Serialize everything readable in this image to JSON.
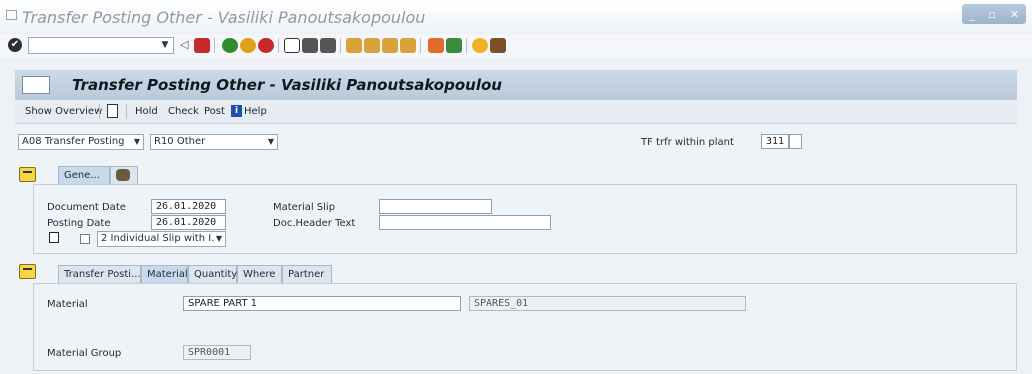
{
  "window": {
    "title": "Transfer Posting Other - Vasiliki Panoutsakopoulou",
    "controls": [
      "_",
      "▫",
      "✕"
    ]
  },
  "toolbar": {
    "command_field_value": "",
    "icons": [
      "back-icon",
      "save-icon",
      "back-arrow-icon",
      "exit-icon",
      "cancel-icon",
      "print-icon",
      "find-icon",
      "find-next-icon",
      "first-page-icon",
      "previous-page-icon",
      "next-page-icon",
      "last-page-icon",
      "create-session-icon",
      "shortcut-icon",
      "help-icon",
      "customize-icon"
    ]
  },
  "header": {
    "title": "Transfer Posting Other - Vasiliki Panoutsakopoulou"
  },
  "appbar": {
    "show_overview": "Show Overview",
    "hold": "Hold",
    "check": "Check",
    "post": "Post",
    "help": "Help"
  },
  "selection": {
    "transaction": "A08 Transfer Posting",
    "reference": "R10 Other",
    "movement_label": "TF trfr within plant",
    "movement_type": "311",
    "special_stock": ""
  },
  "header_tabs": {
    "general": "Gene...",
    "second_icon": "people-icon"
  },
  "general": {
    "document_date_label": "Document Date",
    "document_date": "26.01.2020",
    "posting_date_label": "Posting Date",
    "posting_date": "26.01.2020",
    "material_slip_label": "Material Slip",
    "material_slip": "",
    "doc_header_label": "Doc.Header Text",
    "doc_header": "",
    "print_version": "2 Individual Slip with I."
  },
  "item_tabs": [
    "Transfer Posti...",
    "Material",
    "Quantity",
    "Where",
    "Partner"
  ],
  "item": {
    "material_label": "Material",
    "material_value": "SPARE PART 1",
    "material_number": "SPARES_01",
    "material_group_label": "Material Group",
    "material_group_value": "SPR0001"
  },
  "colors": {
    "header_bg": "#c5d4e3",
    "folder": "#f7d54a",
    "help_blue": "#1d4fb0"
  }
}
